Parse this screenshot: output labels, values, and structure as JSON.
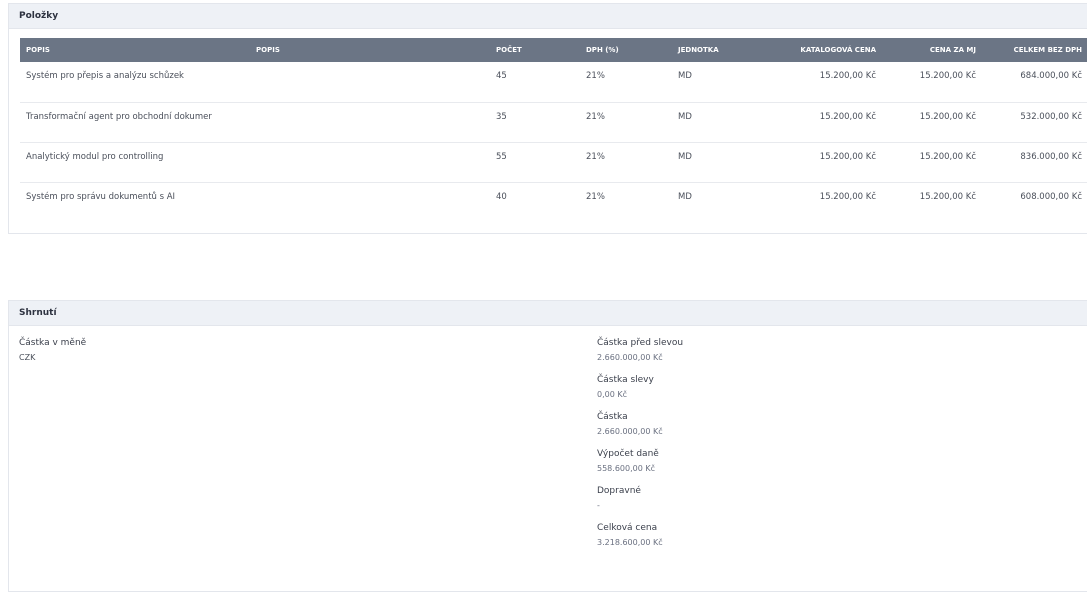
{
  "items_panel": {
    "title": "Položky",
    "columns": [
      "POPIS",
      "POPIS",
      "POČET",
      "DPH (%)",
      "JEDNOTKA",
      "KATALOGOVÁ CENA",
      "CENA ZA MJ",
      "CELKEM BEZ DPH"
    ],
    "rows": [
      {
        "popis": "Systém pro přepis a analýzu schůzek",
        "pocet": "45",
        "dph": "21%",
        "jednotka": "MD",
        "katalogova": "15.200,00 Kč",
        "cena_mj": "15.200,00 Kč",
        "celkem": "684.000,00 Kč"
      },
      {
        "popis": "Transformační agent pro obchodní dokumer",
        "pocet": "35",
        "dph": "21%",
        "jednotka": "MD",
        "katalogova": "15.200,00 Kč",
        "cena_mj": "15.200,00 Kč",
        "celkem": "532.000,00 Kč"
      },
      {
        "popis": "Analytický modul pro controlling",
        "pocet": "55",
        "dph": "21%",
        "jednotka": "MD",
        "katalogova": "15.200,00 Kč",
        "cena_mj": "15.200,00 Kč",
        "celkem": "836.000,00 Kč"
      },
      {
        "popis": "Systém pro správu dokumentů s AI",
        "pocet": "40",
        "dph": "21%",
        "jednotka": "MD",
        "katalogova": "15.200,00 Kč",
        "cena_mj": "15.200,00 Kč",
        "celkem": "608.000,00 Kč"
      }
    ]
  },
  "summary_panel": {
    "title": "Shrnutí",
    "currency_label": "Částka v měně",
    "currency_value": "CZK",
    "fields": [
      {
        "label": "Částka před slevou",
        "value": "2.660.000,00 Kč"
      },
      {
        "label": "Částka slevy",
        "value": "0,00 Kč"
      },
      {
        "label": "Částka",
        "value": "2.660.000,00 Kč"
      },
      {
        "label": "Výpočet daně",
        "value": "558.600,00 Kč"
      },
      {
        "label": "Dopravné",
        "value": "-"
      },
      {
        "label": "Celková cena",
        "value": "3.218.600,00 Kč"
      }
    ]
  },
  "colors": {
    "header_bg": "#6b7585",
    "panel_header_bg": "#eef1f6"
  }
}
